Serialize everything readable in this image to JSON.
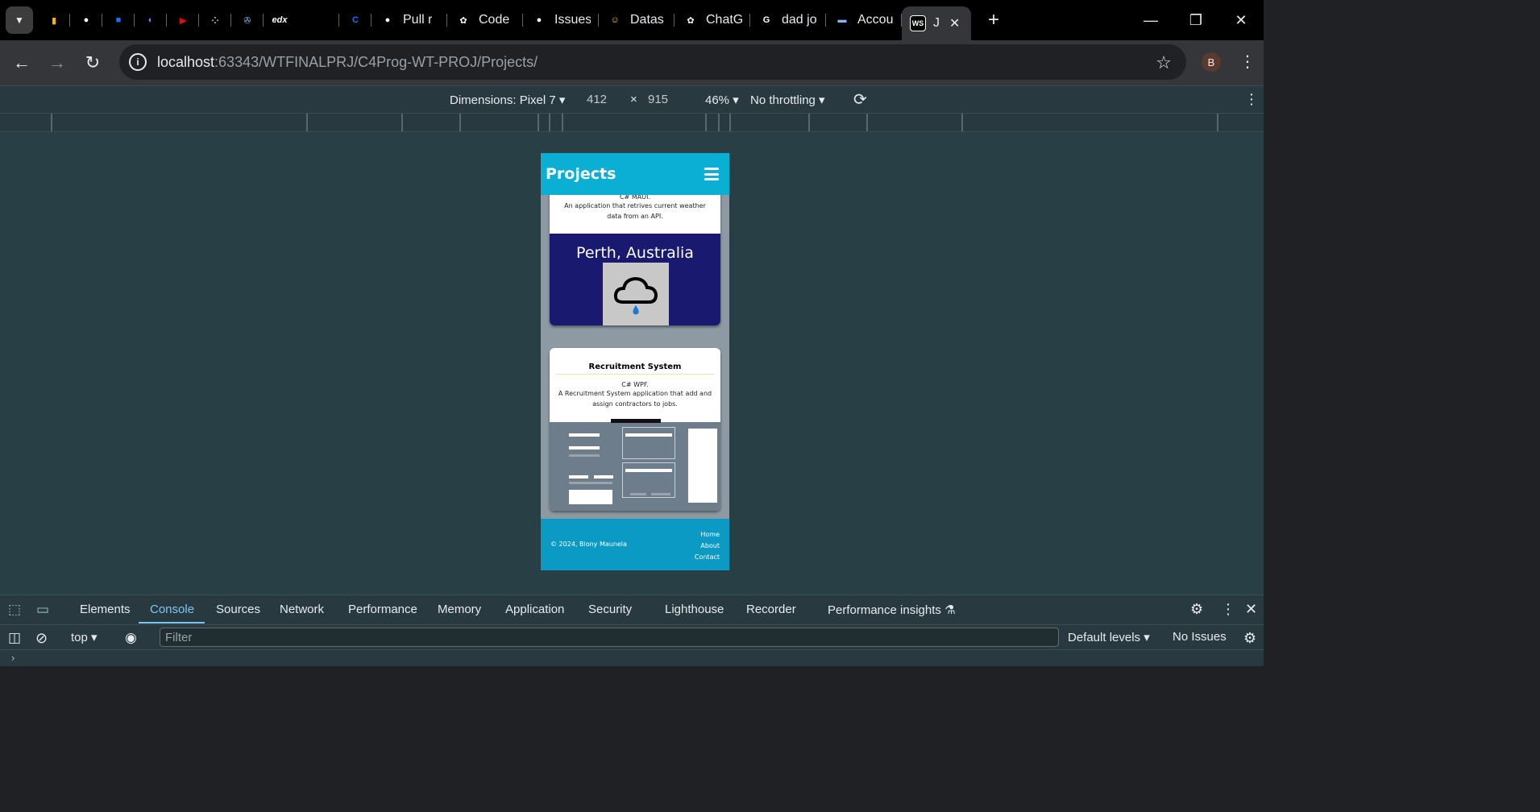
{
  "browser": {
    "tabs": [
      {
        "icon": "analytics-icon",
        "label": "",
        "color": "#f4b400"
      },
      {
        "icon": "github-icon",
        "label": "",
        "color": "#ffffff"
      },
      {
        "icon": "windows-icon",
        "label": "",
        "color": "#1a73e8"
      },
      {
        "icon": "linear-icon",
        "label": "",
        "color": "#7b7ff5"
      },
      {
        "icon": "youtube-icon",
        "label": "",
        "color": "#ff0000"
      },
      {
        "icon": "dots-icon",
        "label": "",
        "color": "#cccccc"
      },
      {
        "icon": "film-icon",
        "label": "",
        "color": "#8ab4f8"
      },
      {
        "icon": "edx-icon",
        "label": "edx",
        "color": "#ffffff"
      },
      {
        "icon": "c-icon",
        "label": "",
        "color": "#1a73e8"
      },
      {
        "icon": "github-icon",
        "label": "Pull r",
        "color": "#ffffff"
      },
      {
        "icon": "chatgpt-icon",
        "label": "Code",
        "color": "#ffffff"
      },
      {
        "icon": "github-icon",
        "label": "Issues",
        "color": "#ffffff"
      },
      {
        "icon": "huggingface-icon",
        "label": "Datas",
        "color": "#ffcc4d"
      },
      {
        "icon": "chatgpt-icon",
        "label": "ChatG",
        "color": "#ffffff"
      },
      {
        "icon": "google-icon",
        "label": "dad jo",
        "color": "#ffffff"
      },
      {
        "icon": "account-icon",
        "label": "Accou",
        "color": "#8ab4f8"
      }
    ],
    "active_tab": {
      "icon": "webstorm-icon",
      "label": "J"
    },
    "url_host": "localhost",
    "url_rest": ":63343/WTFINALPRJ/C4Prog-WT-PROJ/Projects/",
    "profile_initial": "B"
  },
  "device_toolbar": {
    "dimensions_label": "Dimensions: Pixel 7",
    "width": "412",
    "times": "×",
    "height": "915",
    "zoom": "46%",
    "throttling": "No throttling"
  },
  "page": {
    "header_title": "Projects",
    "projects": [
      {
        "title": "",
        "tech": "C# MAUI.",
        "description": "An application that retrives current weather data from an API.",
        "preview_city": "Perth, Australia"
      },
      {
        "title": "Recruitment System",
        "tech": "C# WPF.",
        "description": "A Recruitment System application that add and assign contractors to jobs."
      }
    ],
    "footer": {
      "copyright": "© 2024, Blony Maunela",
      "links": [
        "Home",
        "About",
        "Contact"
      ]
    }
  },
  "devtools": {
    "tabs": [
      "Elements",
      "Console",
      "Sources",
      "Network",
      "Performance",
      "Memory",
      "Application",
      "Security",
      "Lighthouse",
      "Recorder",
      "Performance insights"
    ],
    "active_tab": "Console",
    "context": "top",
    "filter_placeholder": "Filter",
    "levels": "Default levels",
    "issues": "No Issues"
  }
}
